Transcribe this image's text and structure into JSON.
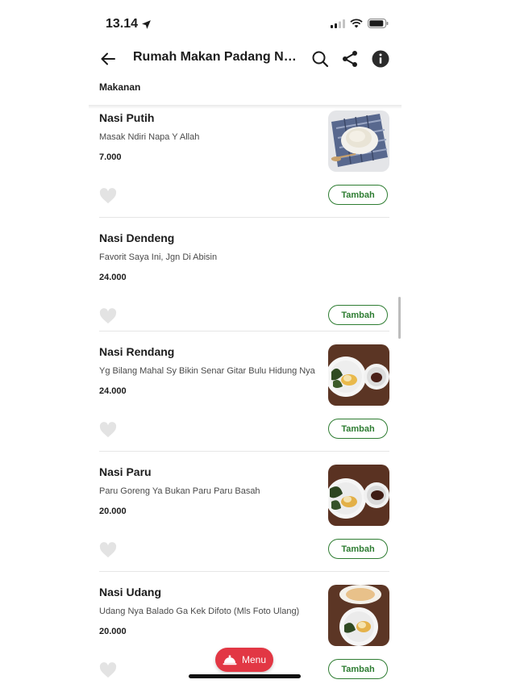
{
  "status_bar": {
    "time": "13.14"
  },
  "header": {
    "title": "Rumah Makan Padang Nasi...",
    "category": "Makanan"
  },
  "items": [
    {
      "name": "Nasi Putih",
      "desc": "Masak Ndiri Napa Y Allah",
      "price": "7.000",
      "add_label": "Tambah"
    },
    {
      "name": "Nasi Dendeng",
      "desc": "Favorit Saya Ini, Jgn Di Abisin",
      "price": "24.000",
      "add_label": "Tambah"
    },
    {
      "name": "Nasi Rendang",
      "desc": "Yg Bilang Mahal Sy Bikin Senar Gitar Bulu Hidung Nya",
      "price": "24.000",
      "add_label": "Tambah"
    },
    {
      "name": "Nasi Paru",
      "desc": "Paru Goreng Ya Bukan Paru Paru Basah",
      "price": "20.000",
      "add_label": "Tambah"
    },
    {
      "name": "Nasi Udang",
      "desc": "Udang Nya Balado Ga Kek Difoto (Mls Foto Ulang)",
      "price": "20.000",
      "add_label": "Tambah"
    }
  ],
  "menu_button": {
    "label": "Menu"
  },
  "colors": {
    "accent_green": "#2e7d32",
    "menu_red": "#e23744"
  }
}
